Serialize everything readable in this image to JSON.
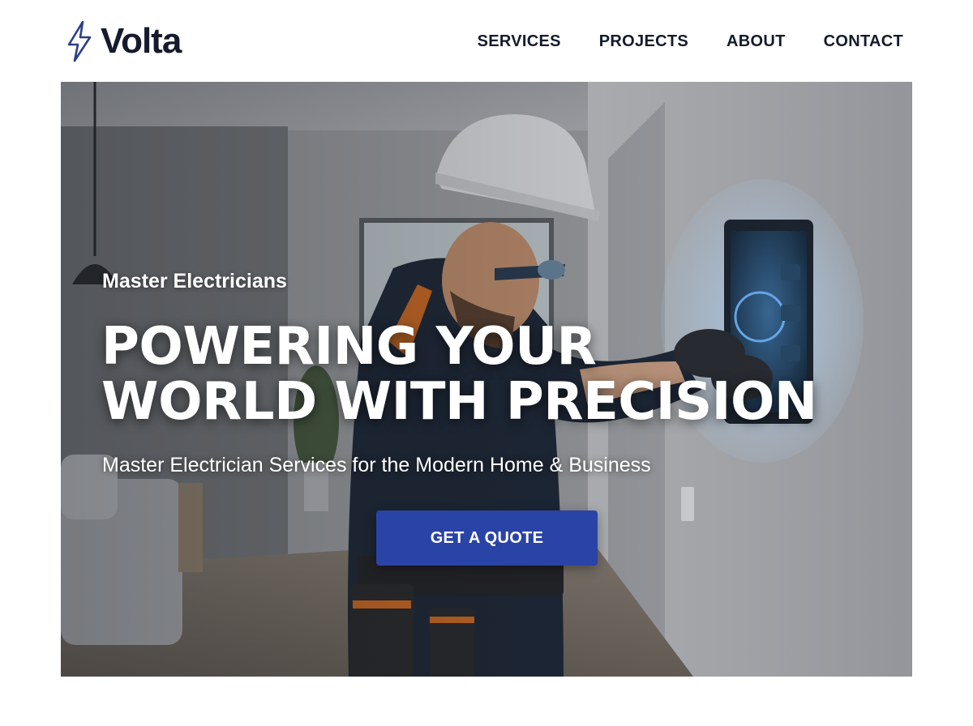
{
  "brand": {
    "name": "Volta",
    "logo_icon": "lightning-bolt-icon",
    "accent_color": "#2a43a6",
    "text_color": "#151a2c"
  },
  "nav": {
    "items": [
      {
        "label": "SERVICES"
      },
      {
        "label": "PROJECTS"
      },
      {
        "label": "ABOUT"
      },
      {
        "label": "CONTACT"
      }
    ]
  },
  "hero": {
    "image_alt": "Electrician in hard hat and safety glasses configuring a wall-mounted smart home touch panel",
    "eyebrow": "Master Electricians",
    "headline_line1": "POWERING YOUR",
    "headline_line2": "WORLD WITH PRECISION",
    "subheading": "Master Electrician Services for the Modern Home & Business",
    "cta_label": "GET A QUOTE"
  }
}
